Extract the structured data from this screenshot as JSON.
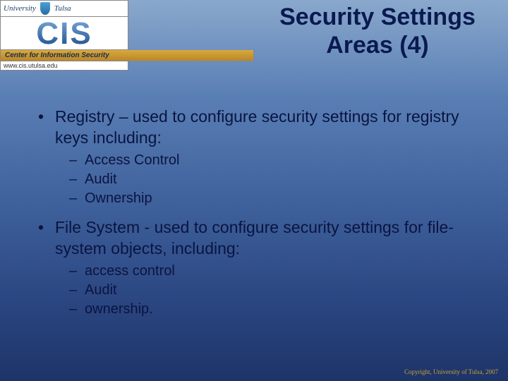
{
  "logo": {
    "university_left": "University",
    "university_right": "Tulsa",
    "cis": "CIS",
    "center_text": "Center for Information Security",
    "url": "www.cis.utulsa.edu"
  },
  "title": "Security Settings Areas (4)",
  "bullets": [
    {
      "text": "Registry – used to configure security settings for registry keys including:",
      "sub": [
        "Access Control",
        "Audit",
        "Ownership"
      ]
    },
    {
      "text": "File System - used to configure security settings for file-system objects, including:",
      "sub": [
        "access control",
        "Audit",
        " ownership."
      ]
    }
  ],
  "footer": "Copyright, University of Tulsa, 2007"
}
